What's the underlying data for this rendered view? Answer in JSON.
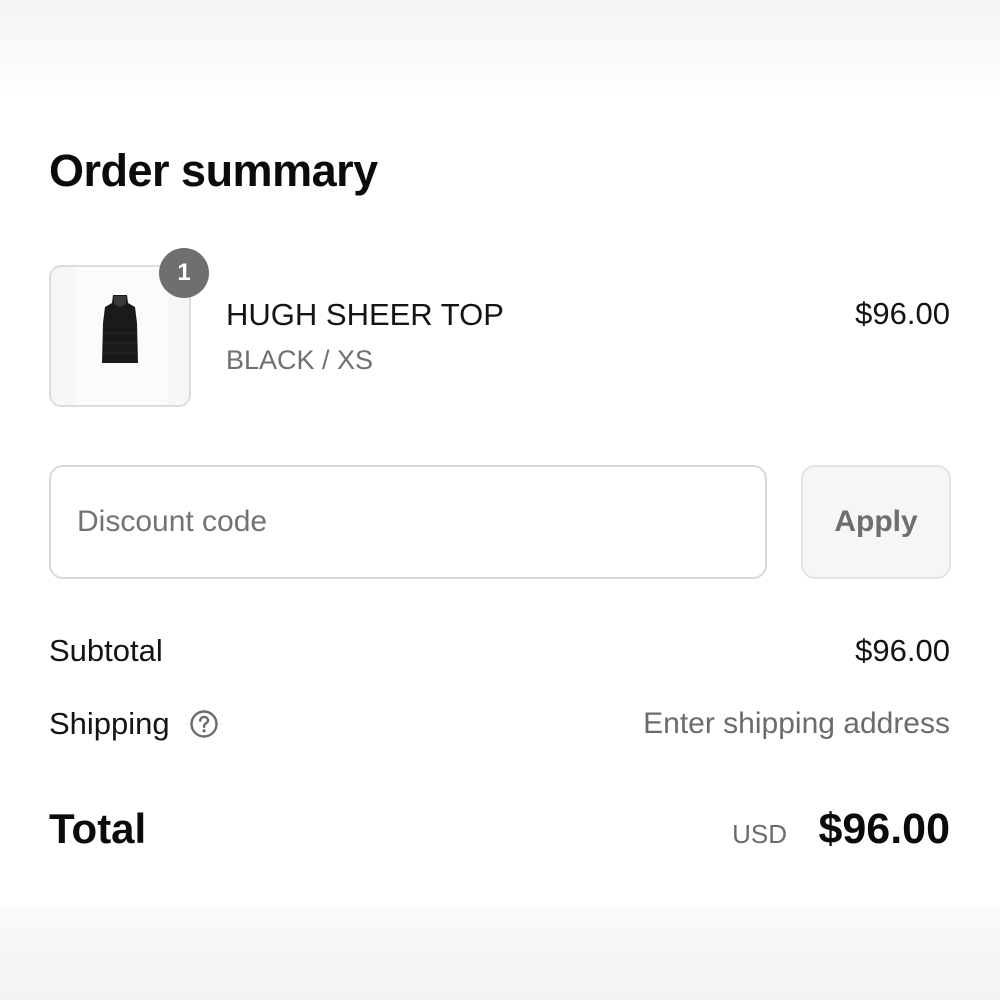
{
  "order_summary": {
    "title": "Order summary"
  },
  "line_item": {
    "quantity": "1",
    "name": "HUGH SHEER TOP",
    "variant": "BLACK / XS",
    "price": "$96.00",
    "thumbnail_icon": "sleeveless-top-icon"
  },
  "discount": {
    "placeholder": "Discount code",
    "value": "",
    "apply_label": "Apply"
  },
  "subtotal": {
    "label": "Subtotal",
    "value": "$96.00"
  },
  "shipping": {
    "label": "Shipping",
    "value": "Enter shipping address",
    "help_icon": "help-circle-icon"
  },
  "total": {
    "label": "Total",
    "currency": "USD",
    "value": "$96.00"
  },
  "colors": {
    "text": "#111111",
    "muted_text": "#707070",
    "border": "#d9d9d9",
    "badge": "#6f6f6f",
    "button_bg": "#f6f6f6"
  }
}
